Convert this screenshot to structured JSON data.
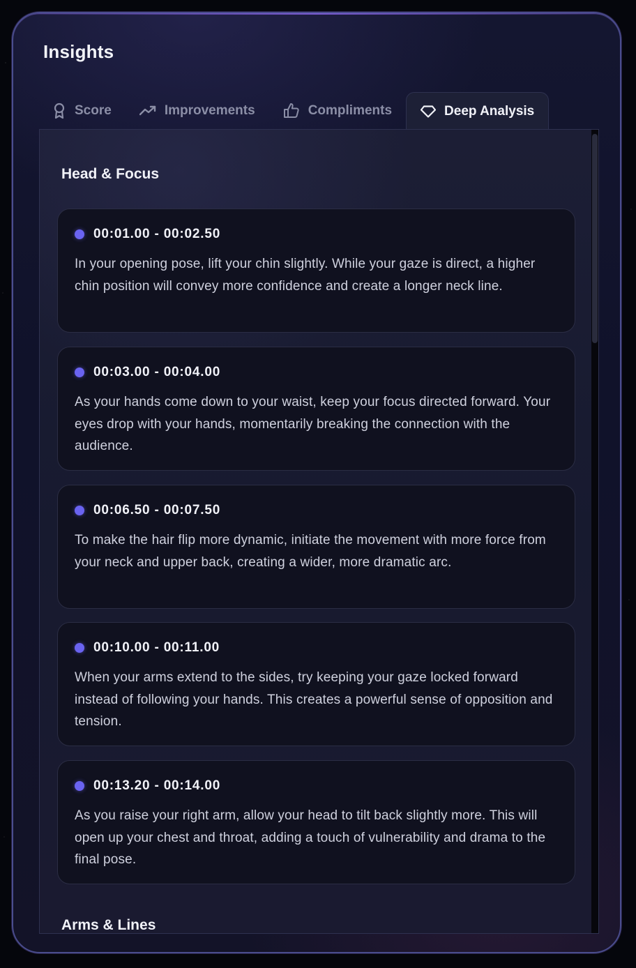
{
  "header": {
    "title": "Insights"
  },
  "tabs": [
    {
      "label": "Score",
      "icon": "award-icon",
      "active": false
    },
    {
      "label": "Improvements",
      "icon": "trending-up-icon",
      "active": false
    },
    {
      "label": "Compliments",
      "icon": "thumbs-up-icon",
      "active": false
    },
    {
      "label": "Deep Analysis",
      "icon": "gem-icon",
      "active": true
    }
  ],
  "sections": [
    {
      "title": "Head & Focus",
      "items": [
        {
          "time": "00:01.00 - 00:02.50",
          "text": "In your opening pose, lift your chin slightly. While your gaze is direct, a higher chin position will convey more confidence and create a longer neck line."
        },
        {
          "time": "00:03.00 - 00:04.00",
          "text": "As your hands come down to your waist, keep your focus directed forward. Your eyes drop with your hands, momentarily breaking the connection with the audience."
        },
        {
          "time": "00:06.50 - 00:07.50",
          "text": "To make the hair flip more dynamic, initiate the movement with more force from your neck and upper back, creating a wider, more dramatic arc."
        },
        {
          "time": "00:10.00 - 00:11.00",
          "text": "When your arms extend to the sides, try keeping your gaze locked forward instead of following your hands. This creates a powerful sense of opposition and tension."
        },
        {
          "time": "00:13.20 - 00:14.00",
          "text": "As you raise your right arm, allow your head to tilt back slightly more. This will open up your chest and throat, adding a touch of vulnerability and drama to the final pose."
        }
      ]
    },
    {
      "title": "Arms & Lines"
    }
  ],
  "colors": {
    "accent_dot": "#6a63f0",
    "card_border": "#4a4d8e",
    "panel_bg": "#1c1e35",
    "item_bg": "#10111f"
  }
}
